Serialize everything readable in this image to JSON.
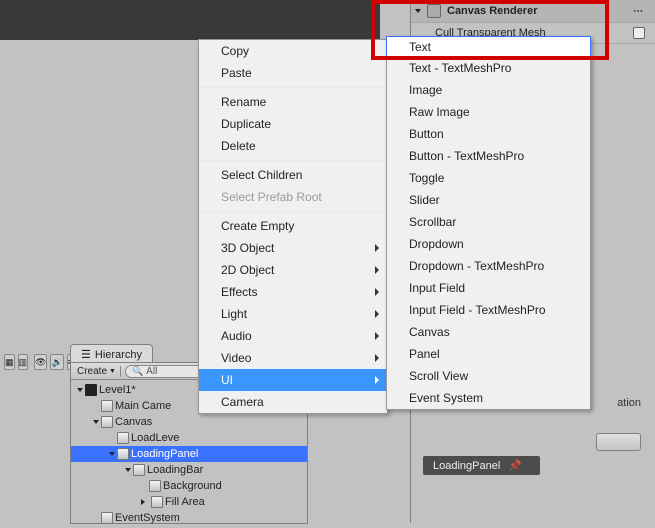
{
  "inspector": {
    "header": "Canvas Renderer",
    "cull": "Cull Transparent Mesh"
  },
  "bottom": {
    "label": "LoadingPanel",
    "ation": "ation"
  },
  "hierarchy": {
    "tab": "Hierarchy",
    "create": "Create",
    "search_placeholder": "All",
    "nodes": [
      {
        "label": "Level1*",
        "icon": "unity",
        "depth": 0,
        "exp": "down"
      },
      {
        "label": "Main Came",
        "icon": "cube",
        "depth": 1
      },
      {
        "label": "Canvas",
        "icon": "cube",
        "depth": 1,
        "exp": "down"
      },
      {
        "label": "LoadLeve",
        "icon": "cube",
        "depth": 2
      },
      {
        "label": "LoadingPanel",
        "icon": "cube",
        "depth": 2,
        "exp": "down",
        "sel": true
      },
      {
        "label": "LoadingBar",
        "icon": "cube",
        "depth": 3,
        "exp": "down"
      },
      {
        "label": "Background",
        "icon": "cube",
        "depth": 4
      },
      {
        "label": "Fill Area",
        "icon": "cube",
        "depth": 4,
        "exp": "right"
      },
      {
        "label": "EventSystem",
        "icon": "cube",
        "depth": 1
      }
    ]
  },
  "menu1": [
    {
      "label": "Copy"
    },
    {
      "label": "Paste"
    },
    {
      "sep": true
    },
    {
      "label": "Rename"
    },
    {
      "label": "Duplicate"
    },
    {
      "label": "Delete"
    },
    {
      "sep": true
    },
    {
      "label": "Select Children"
    },
    {
      "label": "Select Prefab Root",
      "dis": true
    },
    {
      "sep": true
    },
    {
      "label": "Create Empty"
    },
    {
      "label": "3D Object",
      "sub": true
    },
    {
      "label": "2D Object",
      "sub": true
    },
    {
      "label": "Effects",
      "sub": true
    },
    {
      "label": "Light",
      "sub": true
    },
    {
      "label": "Audio",
      "sub": true
    },
    {
      "label": "Video",
      "sub": true
    },
    {
      "label": "UI",
      "sub": true,
      "sel": true
    },
    {
      "label": "Camera"
    }
  ],
  "menu2": [
    {
      "label": "Text",
      "hl": true
    },
    {
      "label": "Text - TextMeshPro"
    },
    {
      "label": "Image"
    },
    {
      "label": "Raw Image"
    },
    {
      "label": "Button"
    },
    {
      "label": "Button - TextMeshPro"
    },
    {
      "label": "Toggle"
    },
    {
      "label": "Slider"
    },
    {
      "label": "Scrollbar"
    },
    {
      "label": "Dropdown"
    },
    {
      "label": "Dropdown - TextMeshPro"
    },
    {
      "label": "Input Field"
    },
    {
      "label": "Input Field - TextMeshPro"
    },
    {
      "label": "Canvas"
    },
    {
      "label": "Panel"
    },
    {
      "label": "Scroll View"
    },
    {
      "label": "Event System"
    }
  ]
}
